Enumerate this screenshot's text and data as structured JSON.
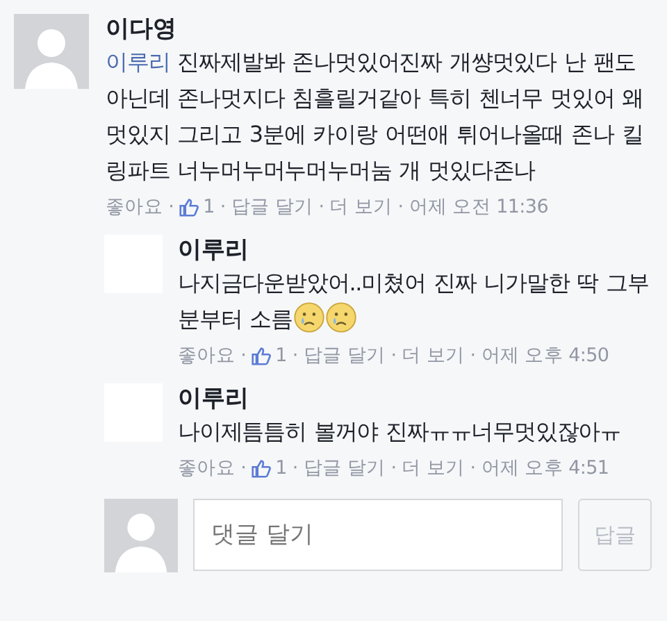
{
  "comment": {
    "author": "이다영",
    "mention": "이루리",
    "text": "진짜제발봐 존나멋있어진짜 개썅멋있다 난 팬도아닌데 존나멋지다 침흘릴거같아 특히 첸너무 멋있어 왜멋있지 그리고 3분에 카이랑 어떤애 튀어나올때 존나 킬링파트 너누머누머누머누머눔 개 멋있다존나",
    "meta": {
      "like": "좋아요",
      "like_count": "1",
      "reply": "답글 달기",
      "more": "더 보기",
      "time": "어제 오전 11:36",
      "separators": [
        "·",
        "·",
        "·",
        "·"
      ]
    }
  },
  "replies": [
    {
      "author": "이루리",
      "text": "나지금다운받았어..미쳤어 진짜 니가말한 딱 그부분부터 소름",
      "emoji": [
        {
          "kind": "crying"
        },
        {
          "kind": "crying"
        }
      ],
      "meta": {
        "like": "좋아요",
        "like_count": "1",
        "reply": "답글 달기",
        "more": "더 보기",
        "time": "어제 오후 4:50",
        "separators": [
          "·",
          "·",
          "·",
          "·"
        ]
      }
    },
    {
      "author": "이루리",
      "text": "나이제틈틈히 볼꺼야 진짜ㅠㅠ너무멋있잖아ㅠ",
      "meta": {
        "like": "좋아요",
        "like_count": "1",
        "reply": "답글 달기",
        "more": "더 보기",
        "time": "어제 오후 4:51",
        "separators": [
          "·",
          "·",
          "·",
          "·"
        ]
      }
    }
  ],
  "composer": {
    "placeholder": "댓글 달기",
    "button": "답글"
  }
}
